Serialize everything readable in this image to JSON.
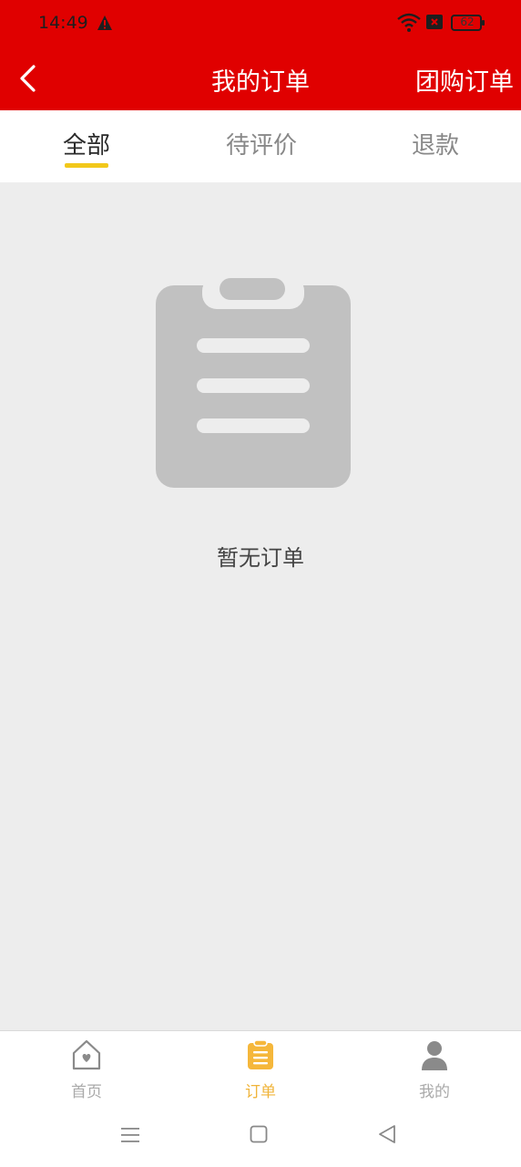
{
  "status_bar": {
    "time": "14:49",
    "battery": "62"
  },
  "app_bar": {
    "title": "我的订单",
    "right_link": "团购订单"
  },
  "tabs": [
    {
      "label": "全部",
      "active": true
    },
    {
      "label": "待评价",
      "active": false
    },
    {
      "label": "退款",
      "active": false
    }
  ],
  "empty_state": {
    "message": "暂无订单"
  },
  "bottom_nav": [
    {
      "label": "首页",
      "icon": "home-icon",
      "active": false
    },
    {
      "label": "订单",
      "icon": "clipboard-icon",
      "active": true
    },
    {
      "label": "我的",
      "icon": "user-icon",
      "active": false
    }
  ],
  "colors": {
    "header_red": "#e00000",
    "accent_yellow": "#f2c81a",
    "nav_active": "#f0b43a"
  }
}
